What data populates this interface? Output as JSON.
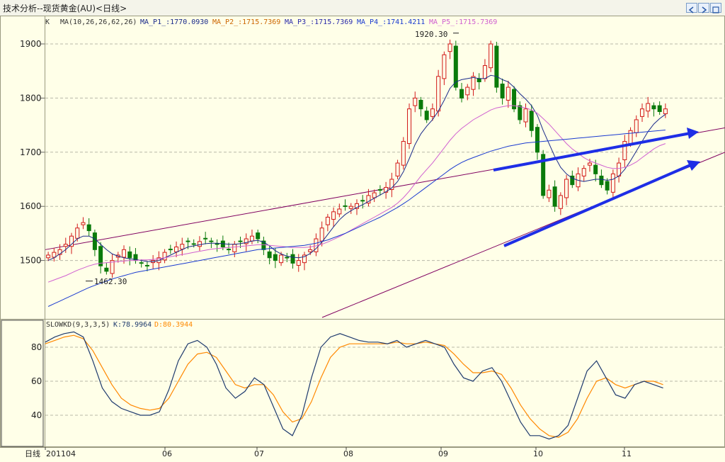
{
  "window": {
    "title": "技术分析--现货黄金(AU)<日线>",
    "buttons": [
      "prev-icon",
      "next-icon",
      "restore-icon"
    ]
  },
  "colors": {
    "background": "#ffffe8",
    "up": "#d21818",
    "down": "#0a7a0a",
    "ma_p1": "#1a2a8a",
    "ma_p2": "#cc6600",
    "ma_p3": "#2a2aaa",
    "ma_p4": "#1a3ad0",
    "ma_p5": "#d060d0",
    "slowk": "#1e3a6e",
    "slowd": "#ff8800",
    "trend": "#800060",
    "arrow": "#1e2ee6"
  },
  "price_panel": {
    "legend_prefix": "K",
    "ma_params": "MA(10,26,26,62,26)",
    "ma_items": [
      {
        "label": "MA_P1_:1770.0930",
        "color": "#1a2a8a"
      },
      {
        "label": "MA_P2_:1715.7369",
        "color": "#cc6600"
      },
      {
        "label": "MA_P3_:1715.7369",
        "color": "#2a2aaa"
      },
      {
        "label": "MA_P4_:1741.4211",
        "color": "#1a3ad0"
      },
      {
        "label": "MA_P5_:1715.7369",
        "color": "#d060d0"
      }
    ],
    "y_ticks": [
      "1900",
      "1800",
      "1700",
      "1600",
      "1500"
    ],
    "high_label": "1920.30",
    "low_label": "1462.30"
  },
  "kd_panel": {
    "legend": "SLOWKD(9,3,3,5)",
    "k_label": "K:78.9964",
    "d_label": "D:80.3944",
    "y_ticks": [
      "80",
      "60",
      "40"
    ]
  },
  "x_axis": {
    "period_label": "日线",
    "ticks": [
      "201104",
      "06",
      "07",
      "08",
      "09",
      "10",
      "11"
    ]
  },
  "chart_data": {
    "type": "line",
    "title": "技术分析--现货黄金(AU)<日线>",
    "x_ticks": [
      "201104",
      "06",
      "07",
      "08",
      "09",
      "10",
      "11"
    ],
    "price_ylim": [
      1410,
      1940
    ],
    "kd_ylim": [
      20,
      95
    ],
    "series": [
      {
        "name": "Close",
        "values": [
          1510,
          1515,
          1520,
          1530,
          1545,
          1560,
          1570,
          1555,
          1520,
          1490,
          1480,
          1500,
          1510,
          1520,
          1505,
          1500,
          1495,
          1490,
          1500,
          1505,
          1515,
          1520,
          1525,
          1530,
          1535,
          1530,
          1535,
          1540,
          1535,
          1530,
          1525,
          1520,
          1530,
          1535,
          1540,
          1545,
          1540,
          1520,
          1505,
          1500,
          1510,
          1505,
          1495,
          1500,
          1510,
          1520,
          1540,
          1560,
          1580,
          1590,
          1595,
          1600,
          1600,
          1605,
          1610,
          1620,
          1625,
          1630,
          1635,
          1650,
          1680,
          1720,
          1780,
          1800,
          1780,
          1760,
          1780,
          1840,
          1880,
          1900,
          1820,
          1800,
          1820,
          1840,
          1830,
          1860,
          1900,
          1820,
          1800,
          1820,
          1780,
          1760,
          1780,
          1740,
          1700,
          1620,
          1630,
          1600,
          1620,
          1650,
          1640,
          1660,
          1670,
          1680,
          1660,
          1640,
          1630,
          1660,
          1680,
          1720,
          1740,
          1760,
          1780,
          1790,
          1780,
          1775,
          1780
        ]
      },
      {
        "name": "MA_P1",
        "values": [
          1500,
          1505,
          1512,
          1520,
          1530,
          1540,
          1545,
          1545,
          1540,
          1530,
          1520,
          1512,
          1508,
          1505,
          1503,
          1502,
          1500,
          1498,
          1498,
          1500,
          1505,
          1510,
          1515,
          1520,
          1525,
          1527,
          1529,
          1531,
          1532,
          1532,
          1531,
          1530,
          1530,
          1531,
          1533,
          1536,
          1537,
          1534,
          1527,
          1518,
          1512,
          1508,
          1506,
          1505,
          1507,
          1513,
          1522,
          1534,
          1548,
          1562,
          1575,
          1585,
          1592,
          1598,
          1603,
          1609,
          1615,
          1621,
          1627,
          1634,
          1646,
          1664,
          1688,
          1714,
          1734,
          1748,
          1760,
          1776,
          1796,
          1818,
          1830,
          1834,
          1836,
          1838,
          1836,
          1836,
          1842,
          1840,
          1834,
          1830,
          1820,
          1808,
          1798,
          1786,
          1768,
          1740,
          1716,
          1692,
          1672,
          1660,
          1652,
          1648,
          1646,
          1648,
          1650,
          1650,
          1648,
          1650,
          1656,
          1668,
          1684,
          1702,
          1720,
          1738,
          1752,
          1762,
          1770
        ]
      },
      {
        "name": "MA_P2",
        "values": [
          1460,
          1464,
          1468,
          1472,
          1477,
          1482,
          1486,
          1490,
          1493,
          1495,
          1496,
          1497,
          1498,
          1499,
          1500,
          1500,
          1501,
          1501,
          1502,
          1503,
          1505,
          1507,
          1509,
          1511,
          1513,
          1515,
          1517,
          1519,
          1521,
          1522,
          1523,
          1524,
          1525,
          1526,
          1527,
          1528,
          1529,
          1529,
          1528,
          1527,
          1526,
          1525,
          1524,
          1524,
          1524,
          1525,
          1527,
          1530,
          1534,
          1539,
          1544,
          1550,
          1556,
          1562,
          1568,
          1574,
          1580,
          1586,
          1592,
          1598,
          1606,
          1616,
          1628,
          1642,
          1656,
          1668,
          1680,
          1694,
          1708,
          1722,
          1734,
          1744,
          1752,
          1760,
          1766,
          1772,
          1778,
          1782,
          1784,
          1786,
          1786,
          1784,
          1782,
          1778,
          1772,
          1762,
          1752,
          1740,
          1728,
          1716,
          1706,
          1698,
          1690,
          1684,
          1680,
          1676,
          1672,
          1670,
          1670,
          1672,
          1676,
          1682,
          1690,
          1698,
          1706,
          1712,
          1716
        ]
      },
      {
        "name": "MA_P4",
        "values": [
          1415,
          1420,
          1425,
          1430,
          1435,
          1440,
          1445,
          1450,
          1454,
          1458,
          1462,
          1466,
          1469,
          1472,
          1475,
          1478,
          1480,
          1482,
          1484,
          1486,
          1488,
          1490,
          1492,
          1494,
          1496,
          1498,
          1500,
          1502,
          1504,
          1506,
          1508,
          1510,
          1512,
          1514,
          1516,
          1518,
          1520,
          1521,
          1522,
          1523,
          1524,
          1525,
          1526,
          1527,
          1528,
          1530,
          1532,
          1535,
          1538,
          1542,
          1546,
          1550,
          1555,
          1560,
          1565,
          1570,
          1575,
          1580,
          1586,
          1592,
          1598,
          1605,
          1612,
          1620,
          1628,
          1636,
          1644,
          1652,
          1660,
          1668,
          1675,
          1681,
          1686,
          1690,
          1694,
          1698,
          1702,
          1705,
          1708,
          1711,
          1713,
          1715,
          1717,
          1718,
          1719,
          1720,
          1721,
          1722,
          1723,
          1724,
          1725,
          1726,
          1727,
          1728,
          1729,
          1730,
          1731,
          1732,
          1733,
          1734,
          1735,
          1736,
          1737,
          1738,
          1739,
          1740,
          1741
        ]
      },
      {
        "name": "SLOWK",
        "values": [
          83,
          86,
          88,
          89,
          86,
          72,
          56,
          48,
          44,
          42,
          40,
          40,
          42,
          55,
          72,
          82,
          84,
          80,
          70,
          56,
          50,
          54,
          62,
          58,
          45,
          32,
          28,
          40,
          62,
          80,
          86,
          88,
          86,
          84,
          83,
          83,
          82,
          84,
          80,
          82,
          84,
          82,
          80,
          70,
          62,
          60,
          66,
          68,
          60,
          48,
          36,
          28,
          28,
          26,
          28,
          34,
          50,
          66,
          72,
          62,
          52,
          50,
          58,
          60,
          58,
          56
        ]
      },
      {
        "name": "SLOWD",
        "values": [
          82,
          84,
          86,
          87,
          85,
          78,
          68,
          58,
          50,
          46,
          44,
          43,
          44,
          50,
          60,
          70,
          76,
          77,
          74,
          66,
          58,
          56,
          58,
          58,
          52,
          42,
          36,
          38,
          48,
          62,
          74,
          80,
          82,
          82,
          82,
          82,
          82,
          83,
          82,
          82,
          83,
          82,
          81,
          76,
          70,
          65,
          65,
          66,
          64,
          56,
          46,
          38,
          32,
          28,
          27,
          30,
          38,
          50,
          60,
          62,
          58,
          56,
          58,
          60,
          60,
          58
        ]
      }
    ]
  }
}
